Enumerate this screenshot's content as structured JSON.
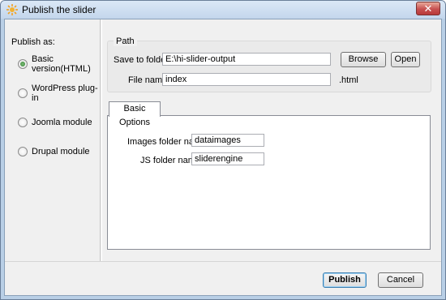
{
  "window": {
    "title": "Publish the slider"
  },
  "sidebar": {
    "heading": "Publish as:",
    "options": [
      {
        "label": "Basic version(HTML)",
        "checked": true
      },
      {
        "label": "WordPress plug-in",
        "checked": false
      },
      {
        "label": "Joomla module",
        "checked": false
      },
      {
        "label": "Drupal module",
        "checked": false
      }
    ]
  },
  "path": {
    "group_label": "Path",
    "save_to_label": "Save to folder:",
    "save_to_value": "E:\\hi-slider-output",
    "browse_label": "Browse",
    "open_label": "Open",
    "file_name_label": "File name:",
    "file_name_value": "index",
    "extension": ".html"
  },
  "tabs": [
    {
      "label": "Basic Options",
      "active": true
    }
  ],
  "basic_options": {
    "images_label": "Images folder name:",
    "images_value": "dataimages",
    "js_label": "JS folder name:",
    "js_value": "sliderengine"
  },
  "footer": {
    "publish_label": "Publish",
    "cancel_label": "Cancel"
  }
}
